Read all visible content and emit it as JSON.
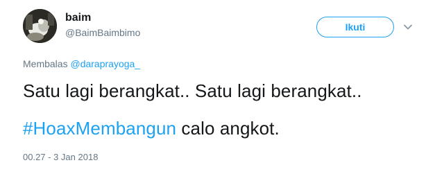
{
  "user": {
    "display_name": "baim",
    "screen_name": "@BaimBaimbimo"
  },
  "follow_button": {
    "label": "Ikuti"
  },
  "reply": {
    "prefix": "Membalas",
    "mention": "@daraprayoga_"
  },
  "tweet": {
    "line1": "Satu lagi berangkat.. Satu lagi berangkat..",
    "hashtag": "#HoaxMembangun",
    "line2_rest": " calo angkot."
  },
  "timestamp": "00.27 - 3 Jan 2018",
  "icons": {
    "avatar": "avatar",
    "menu": "chevron-down-icon"
  },
  "colors": {
    "accent": "#1da1f2",
    "text": "#14171a",
    "secondary": "#657786"
  }
}
